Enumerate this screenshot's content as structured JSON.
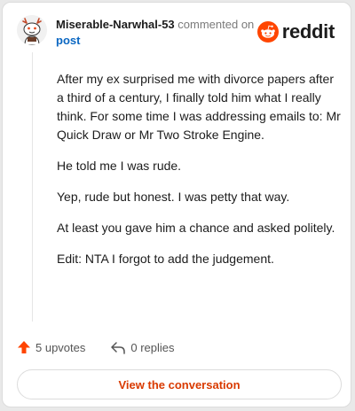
{
  "comment": {
    "username": "Miserable-Narwhal-53",
    "commented_text": "commented on",
    "post_link": "post",
    "paragraphs": [
      "After my ex surprised me with divorce papers after a third of a century, I finally told him what I really think. For some time I was addressing emails to: Mr Quick Draw or Mr Two Stroke Engine.",
      "He told me I was rude.",
      "Yep, rude but honest. I was petty that way.",
      "At least you gave him a chance and asked politely.",
      "Edit: NTA I forgot to add the judgement."
    ]
  },
  "brand": {
    "name": "reddit",
    "color": "#ff4500",
    "icon": "reddit-logo-icon"
  },
  "actions": {
    "upvotes": "5 upvotes",
    "replies": "0 replies",
    "upvote_color": "#ff4500"
  },
  "cta_label": "View the conversation",
  "cta_color": "#d93a00"
}
